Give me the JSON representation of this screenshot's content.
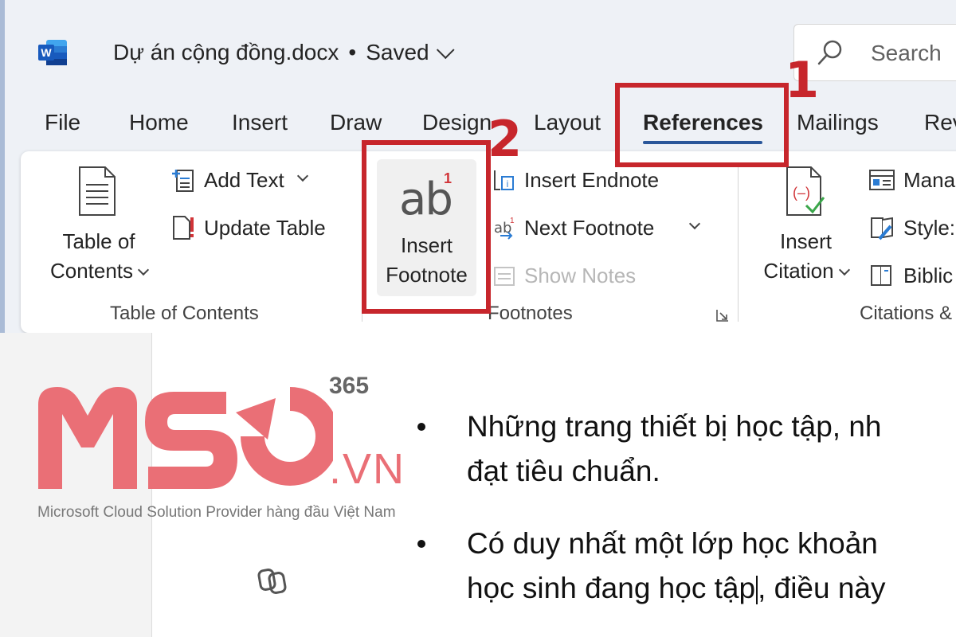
{
  "title_bar": {
    "doc_name": "Dự án cộng đồng.docx",
    "separator": "•",
    "save_status": "Saved",
    "search_placeholder": "Search"
  },
  "tabs": [
    "File",
    "Home",
    "Insert",
    "Draw",
    "Design",
    "Layout",
    "References",
    "Mailings",
    "Rev"
  ],
  "active_tab": "References",
  "ribbon": {
    "toc_group": {
      "big_button": [
        "Table of",
        "Contents"
      ],
      "add_text": "Add Text",
      "update_table": "Update Table",
      "label": "Table of Contents"
    },
    "footnotes_group": {
      "insert_footnote": [
        "Insert",
        "Footnote"
      ],
      "icon_text": "ab",
      "icon_sup": "1",
      "insert_endnote": "Insert Endnote",
      "next_footnote": "Next Footnote",
      "show_notes": "Show Notes",
      "label": "Footnotes"
    },
    "citations_group": {
      "insert_citation": [
        "Insert",
        "Citation"
      ],
      "manage": "Mana",
      "style": "Style:",
      "bibliography": "Biblic",
      "label": "Citations &"
    }
  },
  "annotations": {
    "step1": "1",
    "step2": "2"
  },
  "document": {
    "bullet1_line1": "Những trang thiết bị học tập, nh",
    "bullet1_line2": "đạt tiêu chuẩn.",
    "bullet2_line1": "Có duy nhất một lớp học khoản",
    "bullet2_line2a": "học sinh đang học tập",
    "bullet2_line2b": ", điều này"
  },
  "watermark": {
    "brand_365": "365",
    "brand_tld": ".VN",
    "tagline": "Microsoft Cloud Solution Provider hàng đầu Việt Nam"
  },
  "colors": {
    "accent": "#2b579a",
    "annotation": "#c7262c",
    "logo": "#ea6f76"
  }
}
